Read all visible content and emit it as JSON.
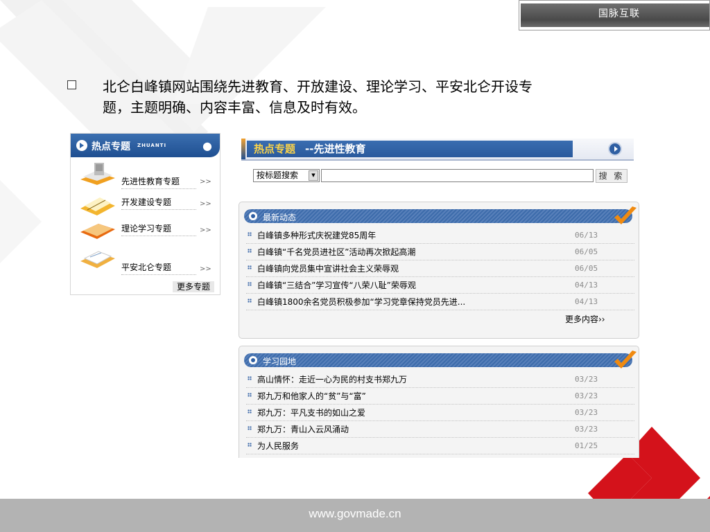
{
  "brand": {
    "name": "国脉互联"
  },
  "intro": {
    "text": "北仑白峰镇网站围绕先进教育、开放建设、理论学习、平安北仑开设专题，主题明确、内容丰富、信息及时有效。"
  },
  "hot_panel": {
    "title": "热点专题",
    "subtitle": "ZHUANTI",
    "topics": [
      {
        "label": "先进性教育专题",
        "arrow": ">>"
      },
      {
        "label": "开发建设专题",
        "arrow": ">>"
      },
      {
        "label": "理论学习专题",
        "arrow": ">>"
      },
      {
        "label": "平安北仑专题",
        "arrow": ">>"
      }
    ],
    "more_label": "更多专题"
  },
  "portal": {
    "title_highlight": "热点专题",
    "title_tail": "--先进性教育",
    "search": {
      "select_value": "按标题搜索",
      "input_value": "",
      "button_label": "搜 索"
    },
    "news": {
      "title": "最新动态",
      "items": [
        {
          "title": "白峰镇多种形式庆祝建党85周年",
          "date": "06/13"
        },
        {
          "title": "白峰镇“千名党员进社区”活动再次掀起高潮",
          "date": "06/05"
        },
        {
          "title": "白峰镇向党员集中宣讲社会主义荣辱观",
          "date": "06/05"
        },
        {
          "title": "白峰镇“三结合”学习宣传“八荣八耻”荣辱观",
          "date": "04/13"
        },
        {
          "title": "白峰镇1800余名党员积极参加“学习党章保持党员先进...",
          "date": "04/13"
        }
      ],
      "more_label": "更多内容››"
    },
    "study": {
      "title": "学习园地",
      "items": [
        {
          "title": "高山情怀：走近一心为民的村支书郑九万",
          "date": "03/23"
        },
        {
          "title": "郑九万和他家人的“贫”与“富”",
          "date": "03/23"
        },
        {
          "title": "郑九万：平凡支书的如山之爱",
          "date": "03/23"
        },
        {
          "title": "郑九万：青山入云风涌动",
          "date": "03/23"
        },
        {
          "title": "为人民服务",
          "date": "01/25"
        }
      ]
    }
  },
  "footer": {
    "url": "www.govmade.cn"
  }
}
